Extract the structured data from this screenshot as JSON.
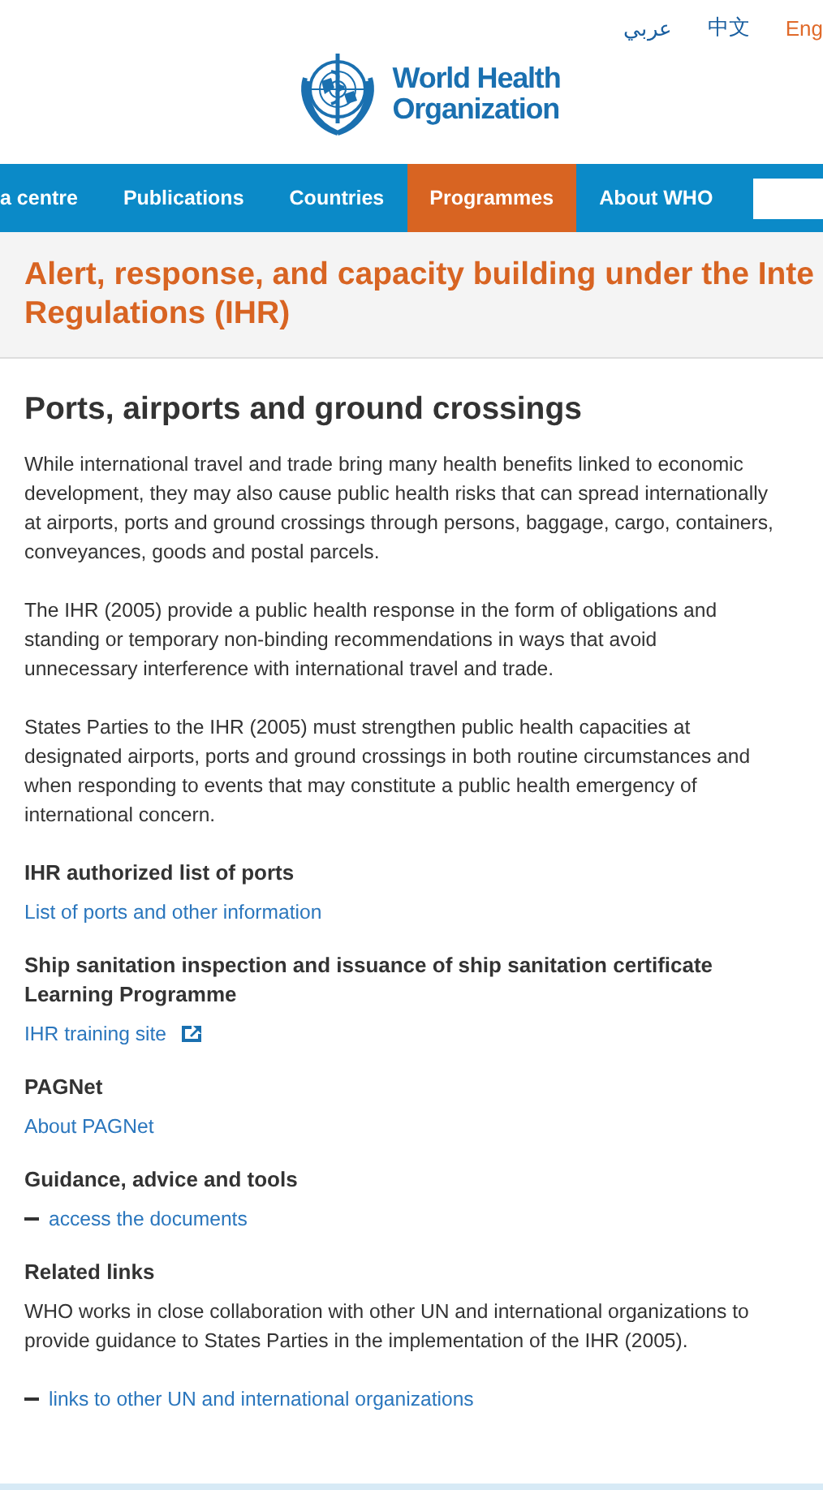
{
  "languages": [
    {
      "label": "عربي",
      "selected": false
    },
    {
      "label": "中文",
      "selected": false
    },
    {
      "label": "Eng",
      "selected": true
    }
  ],
  "logo": {
    "line1": "World Health",
    "line2": "Organization"
  },
  "nav": [
    {
      "label": "a centre",
      "selected": false
    },
    {
      "label": "Publications",
      "selected": false
    },
    {
      "label": "Countries",
      "selected": false
    },
    {
      "label": "Programmes",
      "selected": true
    },
    {
      "label": "About WHO",
      "selected": false
    }
  ],
  "banner": {
    "title_lines": [
      "Alert, response, and capacity building under the Inte",
      "Regulations (IHR)"
    ]
  },
  "page_title": "Ports, airports and ground crossings",
  "content": [
    {
      "kind": "paragraph",
      "text": "While international travel and trade bring many health benefits linked to economic development, they may also cause public health risks that can spread internationally at airports, ports and ground crossings through persons, baggage, cargo, containers, conveyances, goods and postal parcels."
    },
    {
      "kind": "paragraph",
      "text": "The IHR (2005) provide a public health response in the form of obligations and standing or temporary non-binding recommendations in ways that avoid unnecessary interference with international travel and trade."
    },
    {
      "kind": "paragraph",
      "text": "States Parties to the IHR (2005) must strengthen public health capacities at designated airports, ports and ground crossings in both routine circumstances and when responding to events that may constitute a public health emergency of international concern."
    },
    {
      "kind": "heading",
      "text": "IHR authorized list of ports"
    },
    {
      "kind": "link",
      "text": "List of ports and other information",
      "external": false
    },
    {
      "kind": "heading",
      "text": "Ship sanitation inspection and issuance of ship sanitation certificate Learning Programme"
    },
    {
      "kind": "link",
      "text": "IHR training site",
      "external": true
    },
    {
      "kind": "heading",
      "text": "PAGNet"
    },
    {
      "kind": "link",
      "text": "About PAGNet",
      "external": false
    },
    {
      "kind": "heading",
      "text": "Guidance, advice and tools"
    },
    {
      "kind": "dash_link",
      "text": "access the documents"
    },
    {
      "kind": "heading",
      "text": "Related links"
    },
    {
      "kind": "paragraph",
      "text": "WHO works in close collaboration with other UN and international organizations to provide guidance to States Parties in the implementation of the IHR (2005)."
    },
    {
      "kind": "dash_link",
      "text": "links to other UN and international organizations"
    }
  ]
}
